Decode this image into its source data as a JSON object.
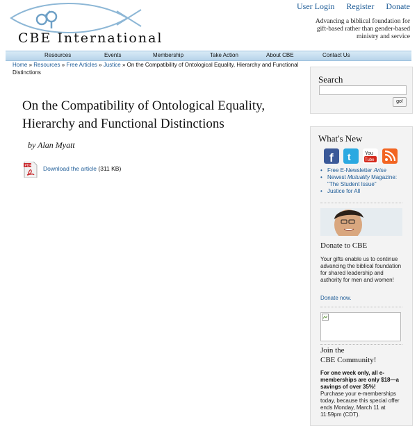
{
  "header": {
    "logo_text": "CBE International",
    "links": [
      "User Login",
      "Register",
      "Donate"
    ],
    "tagline": "Advancing a biblical foundation for gift-based rather than gender-based ministry and service"
  },
  "nav": [
    "Resources",
    "Events",
    "Membership",
    "Take Action",
    "About CBE",
    "Contact Us"
  ],
  "breadcrumb": {
    "links": [
      "Home",
      "Resources",
      "Free Articles",
      "Justice"
    ],
    "separator": "»",
    "current": "On the Compatibility of Ontological Equality, Hierarchy and Functional Distinctions"
  },
  "article": {
    "title": "On the Compatibility of Ontological Equality, Hierarchy and Functional Distinctions",
    "byline": "by Alan Myatt",
    "download_label": "Download the article",
    "file_size": "(311 KB)"
  },
  "sidebar": {
    "search": {
      "heading": "Search",
      "go_label": "go!"
    },
    "whats_new": {
      "heading": "What's New",
      "social_icons": [
        "facebook-icon",
        "twitter-icon",
        "youtube-icon",
        "rss-icon"
      ],
      "news_items": [
        {
          "prefix": "Free E-Newsletter ",
          "emph": "Arise",
          "suffix": ""
        },
        {
          "prefix": "Newest ",
          "emph": "Mutuality",
          "suffix": " Magazine: \"The Student Issue\""
        },
        {
          "prefix": "Justice for All",
          "emph": "",
          "suffix": ""
        }
      ]
    },
    "donate": {
      "heading": "Donate to CBE",
      "text": "Your gifts enable us to continue advancing the biblical foundation for shared leadership and authority for men and women!",
      "link": "Donate now."
    },
    "community": {
      "heading_line1": "Join the",
      "heading_line2": "CBE Community!",
      "bold_text": "For one week only, all e-memberships are only $18—a savings of over 35%!",
      "text": "Purchase your e-memberships today, because this special offer ends Monday, March 11 at 11:59pm (CDT)."
    }
  },
  "colors": {
    "link": "#1b5a96",
    "nav_bg": "#c7dff0",
    "sidebar_bg": "#f3f3f3"
  }
}
